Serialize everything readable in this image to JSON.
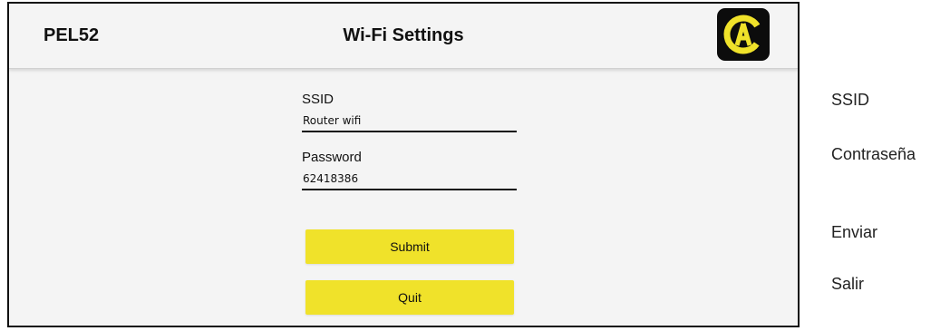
{
  "header": {
    "device_name": "PEL52",
    "title": "Wi-Fi Settings",
    "logo_icon": "chauvin-arnoux-logo-icon"
  },
  "form": {
    "ssid_label": "SSID",
    "ssid_value": "Router wifi",
    "password_label": "Password",
    "password_value": "62418386",
    "submit_label": "Submit",
    "quit_label": "Quit"
  },
  "annotations": {
    "ssid": "SSID",
    "password": "Contraseña",
    "submit": "Enviar",
    "quit": "Salir"
  },
  "colors": {
    "button_accent": "#f0e22a",
    "logo_background": "#0c0c0c",
    "logo_foreground": "#f0e22a",
    "panel_background": "#f4f4f4"
  }
}
